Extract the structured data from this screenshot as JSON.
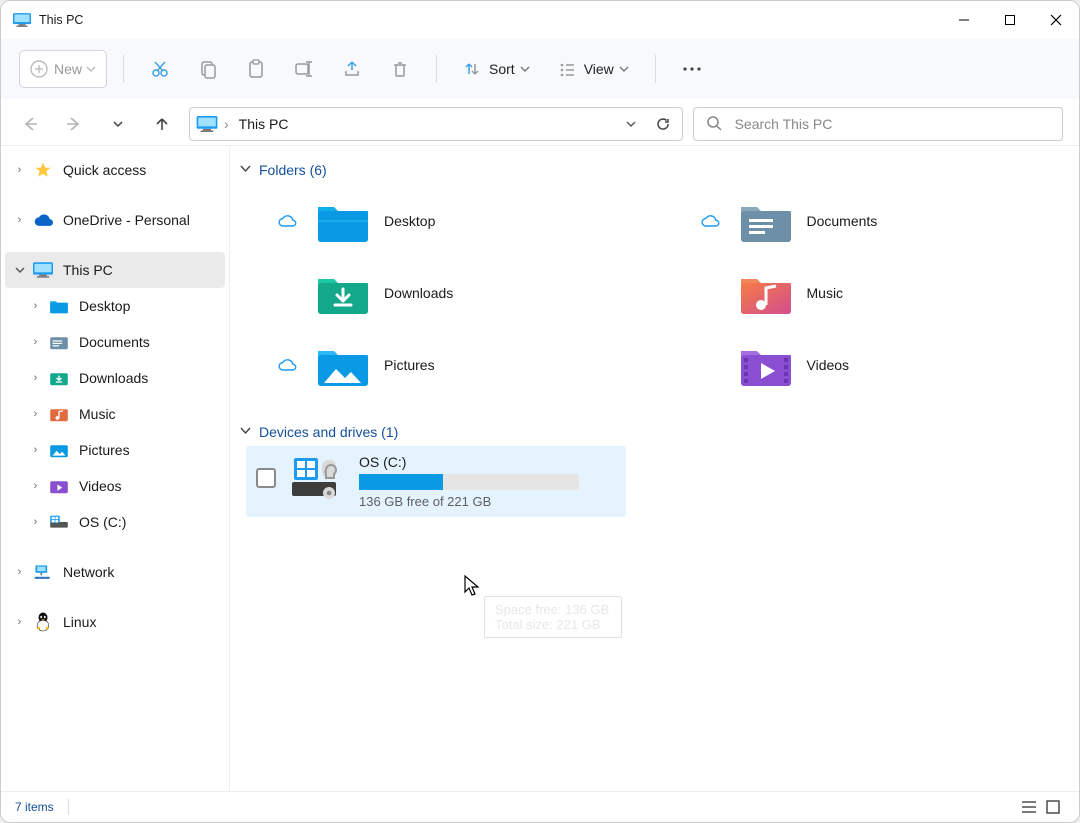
{
  "window": {
    "title": "This PC"
  },
  "toolbar": {
    "new": "New",
    "sort_label": "Sort",
    "view_label": "View"
  },
  "address": {
    "crumb": "This PC",
    "search_placeholder": "Search This PC"
  },
  "sidebar": {
    "quick_access": "Quick access",
    "onedrive": "OneDrive - Personal",
    "this_pc": "This PC",
    "desktop": "Desktop",
    "documents": "Documents",
    "downloads": "Downloads",
    "music": "Music",
    "pictures": "Pictures",
    "videos": "Videos",
    "os_c": "OS (C:)",
    "network": "Network",
    "linux": "Linux"
  },
  "groups": {
    "folders_header": "Folders (6)",
    "drives_header": "Devices and drives (1)"
  },
  "folders": {
    "desktop": "Desktop",
    "documents": "Documents",
    "downloads": "Downloads",
    "music": "Music",
    "pictures": "Pictures",
    "videos": "Videos"
  },
  "drive": {
    "name": "OS (C:)",
    "free_text": "136 GB free of 221 GB",
    "fill_percent": 38,
    "tooltip_line1": "Space free: 136 GB",
    "tooltip_line2": "Total size: 221 GB"
  },
  "status": {
    "items": "7 items"
  }
}
